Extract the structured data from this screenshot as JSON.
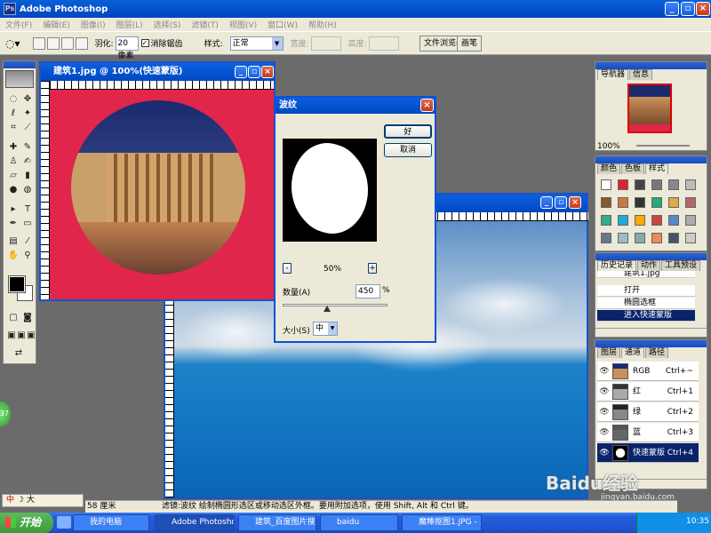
{
  "app": {
    "title": "Adobe Photoshop",
    "logo": "Ps"
  },
  "menu": [
    "文件(F)",
    "编辑(E)",
    "图像(I)",
    "图层(L)",
    "选择(S)",
    "滤镜(T)",
    "视图(V)",
    "窗口(W)",
    "帮助(H)"
  ],
  "options": {
    "feather_label": "羽化:",
    "feather_value": "20 像素",
    "antialias_label": "消除锯齿",
    "style_label": "样式:",
    "style_value": "正常",
    "width_label": "宽度:",
    "height_label": "高度:",
    "file_browser": "文件浏览器",
    "brushes": "画笔"
  },
  "doc1": {
    "title": "建筑1.jpg @ 100%(快速蒙版)"
  },
  "dialog": {
    "title": "波纹",
    "ok": "好",
    "cancel": "取消",
    "zoom": "50%",
    "minus": "-",
    "plus": "+",
    "amount_label": "数量(A)",
    "amount_value": "450",
    "amount_unit": "%",
    "size_label": "大小(S)",
    "size_value": "中",
    "amount_fraction": 0.42
  },
  "panels": {
    "navigator": {
      "tabs": [
        "导航器",
        "信息"
      ],
      "zoom": "100%"
    },
    "swatches": {
      "tabs": [
        "颜色",
        "色板",
        "样式"
      ]
    },
    "history": {
      "tabs": [
        "历史记录",
        "动作",
        "工具预设"
      ],
      "items": [
        "建筑1.jpg",
        "打开",
        "椭圆选框",
        "进入快速蒙版"
      ]
    },
    "channels": {
      "tabs": [
        "图层",
        "通道",
        "路径"
      ],
      "rows": [
        {
          "name": "RGB",
          "shortcut": "Ctrl+~"
        },
        {
          "name": "红",
          "shortcut": "Ctrl+1"
        },
        {
          "name": "绿",
          "shortcut": "Ctrl+2"
        },
        {
          "name": "蓝",
          "shortcut": "Ctrl+3"
        },
        {
          "name": "快速蒙版",
          "shortcut": "Ctrl+4"
        }
      ]
    }
  },
  "status": {
    "doc_size": "58 厘米",
    "hint": "滤镜:波纹   绘制椭圆形选区或移动选区外框。要用附加选项，使用 Shift, Alt 和 Ctrl 键。"
  },
  "ime": {
    "text": "中",
    "label": "大"
  },
  "badge": "37",
  "taskbar": {
    "start": "开始",
    "tasks": [
      "我的电脑",
      "Adobe Photoshop",
      "建筑_百度图片搜...",
      "baidu",
      "魔棒抠图1.JPG - ..."
    ],
    "clock": "10:35"
  },
  "watermark": {
    "brand": "Baidu经验",
    "url": "jingyan.baidu.com"
  }
}
